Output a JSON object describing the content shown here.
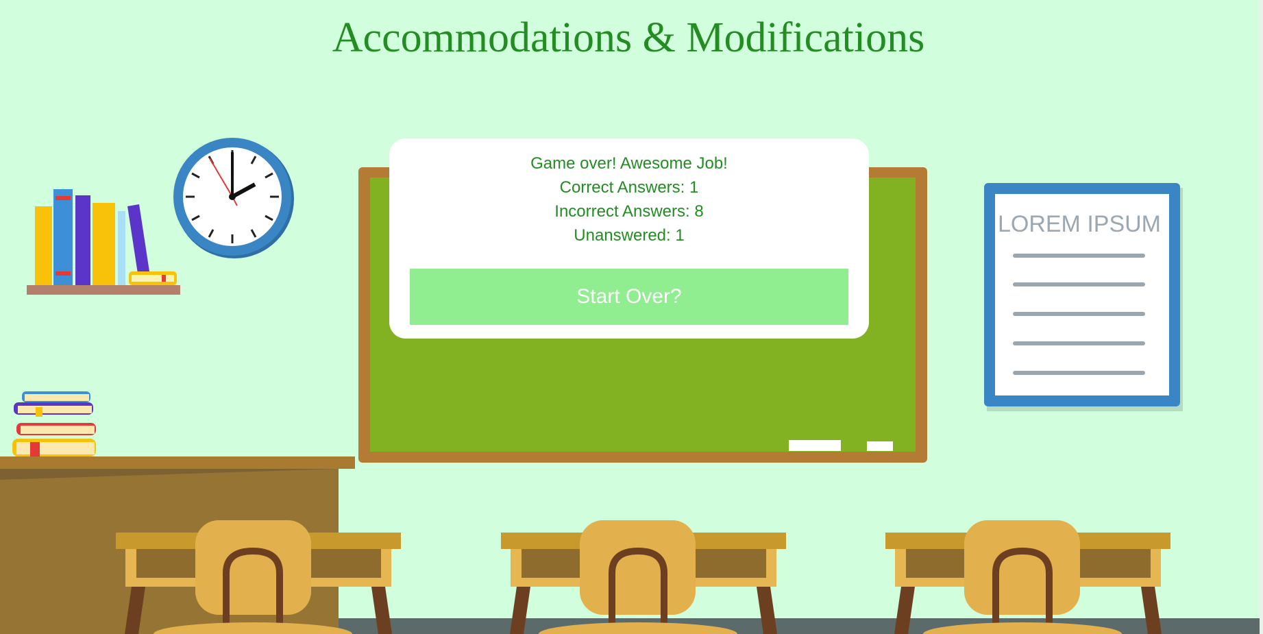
{
  "title": "Accommodations & Modifications",
  "poster": {
    "heading": "LOREM IPSUM"
  },
  "results": {
    "headline": "Game over! Awesome Job!",
    "correct": "Correct Answers: 1",
    "incorrect": "Incorrect Answers: 8",
    "unanswered": "Unanswered: 1"
  },
  "start_over_label": "Start Over?",
  "colors": {
    "background": "#d1fedc",
    "title": "#238c23",
    "button": "#90ee90",
    "chalkboard": "#82b222",
    "chalkboard_frame": "#b47b34"
  },
  "icons": [
    "wall-clock-icon",
    "bookshelf-icon",
    "book-stack-icon",
    "poster-icon",
    "chalkboard-icon",
    "desk-icon",
    "chair-icon"
  ]
}
